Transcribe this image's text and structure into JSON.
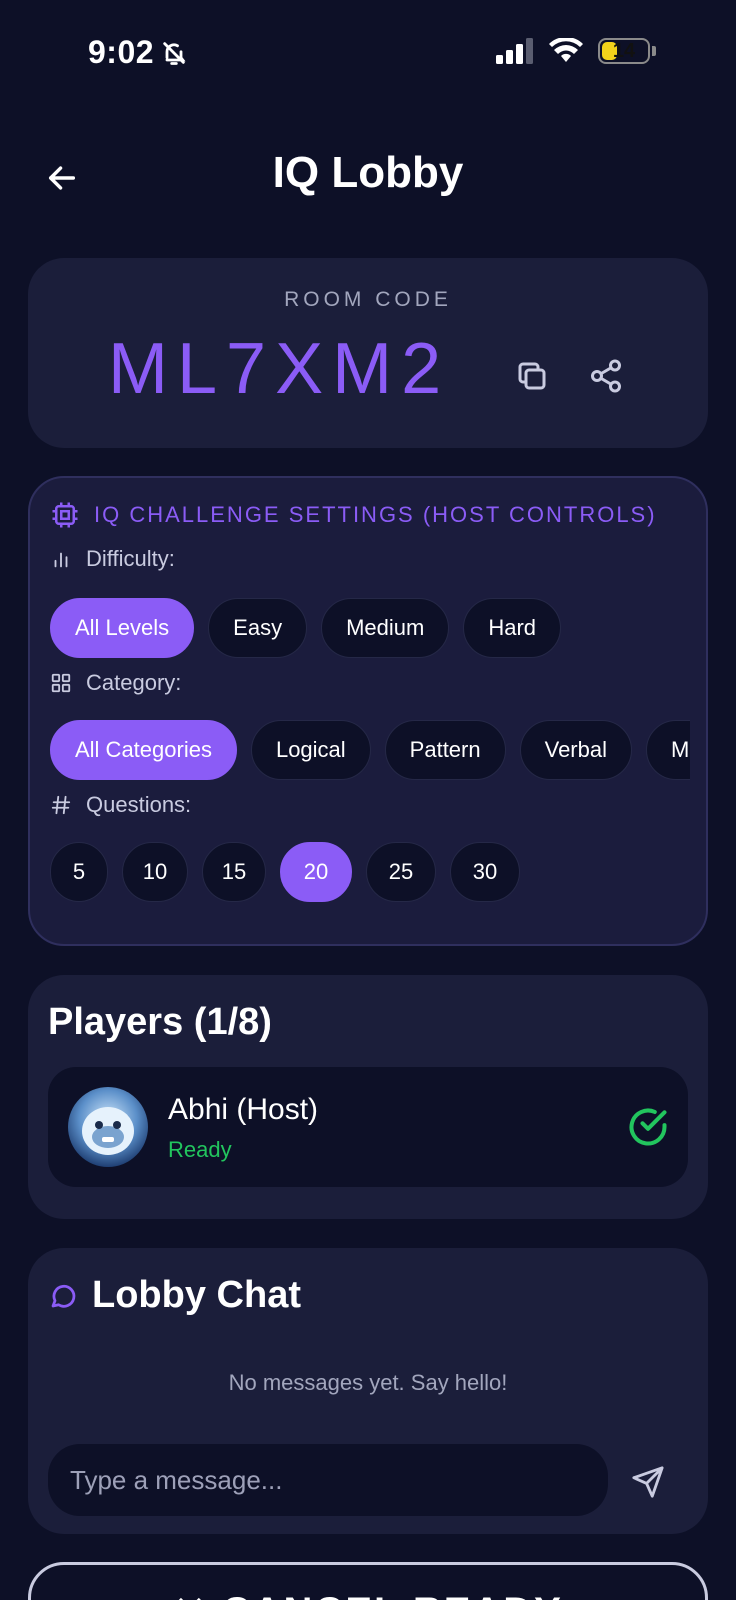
{
  "status_bar": {
    "time": "9:02",
    "battery": "14",
    "battery_level": 0.14
  },
  "header": {
    "title": "IQ Lobby",
    "back_icon": "arrow-left-icon"
  },
  "room": {
    "label": "ROOM CODE",
    "code": "ML7XM2",
    "copy_icon": "copy-icon",
    "share_icon": "share-icon"
  },
  "settings": {
    "title": "IQ CHALLENGE SETTINGS (HOST CONTROLS)",
    "difficulty": {
      "label": "Difficulty:",
      "options": [
        "All Levels",
        "Easy",
        "Medium",
        "Hard"
      ],
      "selected": "All Levels"
    },
    "category": {
      "label": "Category:",
      "options": [
        "All Categories",
        "Logical",
        "Pattern",
        "Verbal",
        "Ma"
      ],
      "selected": "All Categories"
    },
    "questions": {
      "label": "Questions:",
      "options": [
        "5",
        "10",
        "15",
        "20",
        "25",
        "30"
      ],
      "selected": "20"
    }
  },
  "players": {
    "title": "Players (1/8)",
    "list": [
      {
        "name": "Abhi (Host)",
        "status": "Ready"
      }
    ]
  },
  "chat": {
    "title": "Lobby Chat",
    "empty_text": "No messages yet. Say hello!",
    "input_placeholder": "Type a message..."
  },
  "footer": {
    "cancel_label": "✕ CANCEL READY"
  },
  "colors": {
    "background": "#0d1027",
    "card": "#1b1e3a",
    "accent": "#8b5cf6",
    "ready": "#22c55e"
  }
}
